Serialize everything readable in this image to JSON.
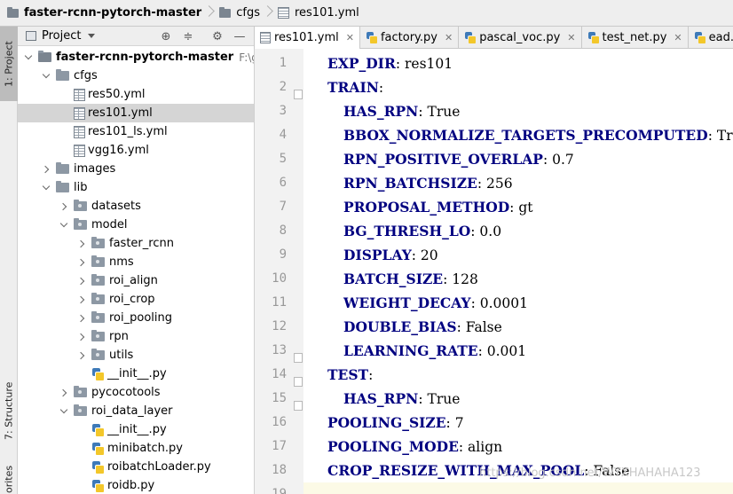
{
  "breadcrumb": {
    "project": "faster-rcnn-pytorch-master",
    "folder": "cfgs",
    "file": "res101.yml"
  },
  "toolstrip": {
    "project_tab": "1: Project",
    "structure_tab": "7: Structure",
    "favorites_tab": "orites"
  },
  "project_panel": {
    "title": "Project",
    "icons": [
      "target-icon",
      "collapse-icon",
      "gear-icon",
      "minimize-icon"
    ]
  },
  "tree": [
    {
      "label": "faster-rcnn-pytorch-master",
      "path": "F:\\g\\ead_",
      "type": "root",
      "expanded": true,
      "depth": 0
    },
    {
      "label": "cfgs",
      "type": "folder",
      "expanded": true,
      "depth": 1
    },
    {
      "label": "res50.yml",
      "type": "yml",
      "depth": 2
    },
    {
      "label": "res101.yml",
      "type": "yml",
      "depth": 2,
      "selected": true
    },
    {
      "label": "res101_ls.yml",
      "type": "yml",
      "depth": 2
    },
    {
      "label": "vgg16.yml",
      "type": "yml",
      "depth": 2
    },
    {
      "label": "images",
      "type": "folder",
      "expanded": false,
      "depth": 1
    },
    {
      "label": "lib",
      "type": "folder",
      "expanded": true,
      "depth": 1
    },
    {
      "label": "datasets",
      "type": "package",
      "expanded": false,
      "depth": 2
    },
    {
      "label": "model",
      "type": "package",
      "expanded": true,
      "depth": 2
    },
    {
      "label": "faster_rcnn",
      "type": "package",
      "expanded": false,
      "depth": 3
    },
    {
      "label": "nms",
      "type": "package",
      "expanded": false,
      "depth": 3
    },
    {
      "label": "roi_align",
      "type": "package",
      "expanded": false,
      "depth": 3
    },
    {
      "label": "roi_crop",
      "type": "package",
      "expanded": false,
      "depth": 3
    },
    {
      "label": "roi_pooling",
      "type": "package",
      "expanded": false,
      "depth": 3
    },
    {
      "label": "rpn",
      "type": "package",
      "expanded": false,
      "depth": 3
    },
    {
      "label": "utils",
      "type": "package",
      "expanded": false,
      "depth": 3
    },
    {
      "label": "__init__.py",
      "type": "py",
      "depth": 3
    },
    {
      "label": "pycocotools",
      "type": "package",
      "expanded": false,
      "depth": 2
    },
    {
      "label": "roi_data_layer",
      "type": "package",
      "expanded": true,
      "depth": 2
    },
    {
      "label": "__init__.py",
      "type": "py",
      "depth": 3
    },
    {
      "label": "minibatch.py",
      "type": "py",
      "depth": 3
    },
    {
      "label": "roibatchLoader.py",
      "type": "py",
      "depth": 3
    },
    {
      "label": "roidb.py",
      "type": "py",
      "depth": 3
    }
  ],
  "tabs": [
    {
      "label": "res101.yml",
      "type": "yml",
      "active": true
    },
    {
      "label": "factory.py",
      "type": "py"
    },
    {
      "label": "pascal_voc.py",
      "type": "py"
    },
    {
      "label": "test_net.py",
      "type": "py"
    },
    {
      "label": "ead.py",
      "type": "py"
    }
  ],
  "tab_close": "✕",
  "editor_lines": [
    {
      "n": "1",
      "key": "EXP_DIR",
      "val": " res101",
      "indent": 0
    },
    {
      "n": "2",
      "key": "TRAIN",
      "val": "",
      "indent": 0,
      "fold": true
    },
    {
      "n": "3",
      "key": "HAS_RPN",
      "val": " True",
      "indent": 1
    },
    {
      "n": "4",
      "key": "BBOX_NORMALIZE_TARGETS_PRECOMPUTED",
      "val": " True",
      "indent": 1
    },
    {
      "n": "5",
      "key": "RPN_POSITIVE_OVERLAP",
      "val": " 0.7",
      "indent": 1
    },
    {
      "n": "6",
      "key": "RPN_BATCHSIZE",
      "val": " 256",
      "indent": 1
    },
    {
      "n": "7",
      "key": "PROPOSAL_METHOD",
      "val": " gt",
      "indent": 1
    },
    {
      "n": "8",
      "key": "BG_THRESH_LO",
      "val": " 0.0",
      "indent": 1
    },
    {
      "n": "9",
      "key": "DISPLAY",
      "val": " 20",
      "indent": 1
    },
    {
      "n": "10",
      "key": "BATCH_SIZE",
      "val": " 128",
      "indent": 1
    },
    {
      "n": "11",
      "key": "WEIGHT_DECAY",
      "val": " 0.0001",
      "indent": 1
    },
    {
      "n": "12",
      "key": "DOUBLE_BIAS",
      "val": " False",
      "indent": 1
    },
    {
      "n": "13",
      "key": "LEARNING_RATE",
      "val": " 0.001",
      "indent": 1,
      "fold": true
    },
    {
      "n": "14",
      "key": "TEST",
      "val": "",
      "indent": 0,
      "fold": true
    },
    {
      "n": "15",
      "key": "HAS_RPN",
      "val": " True",
      "indent": 1,
      "fold": true
    },
    {
      "n": "16",
      "key": "POOLING_SIZE",
      "val": " 7",
      "indent": 0
    },
    {
      "n": "17",
      "key": "POOLING_MODE",
      "val": " align",
      "indent": 0
    },
    {
      "n": "18",
      "key": "CROP_RESIZE_WITH_MAX_POOL",
      "val": " False",
      "indent": 0
    },
    {
      "n": "19",
      "key": "",
      "val": "",
      "indent": 0,
      "current": true
    }
  ],
  "watermark": "https://blog.csdn.net/WYXHAHAHA123",
  "colors": {
    "key": "#000080",
    "selection": "#d5d5d5",
    "current_line": "#fcfae6"
  }
}
